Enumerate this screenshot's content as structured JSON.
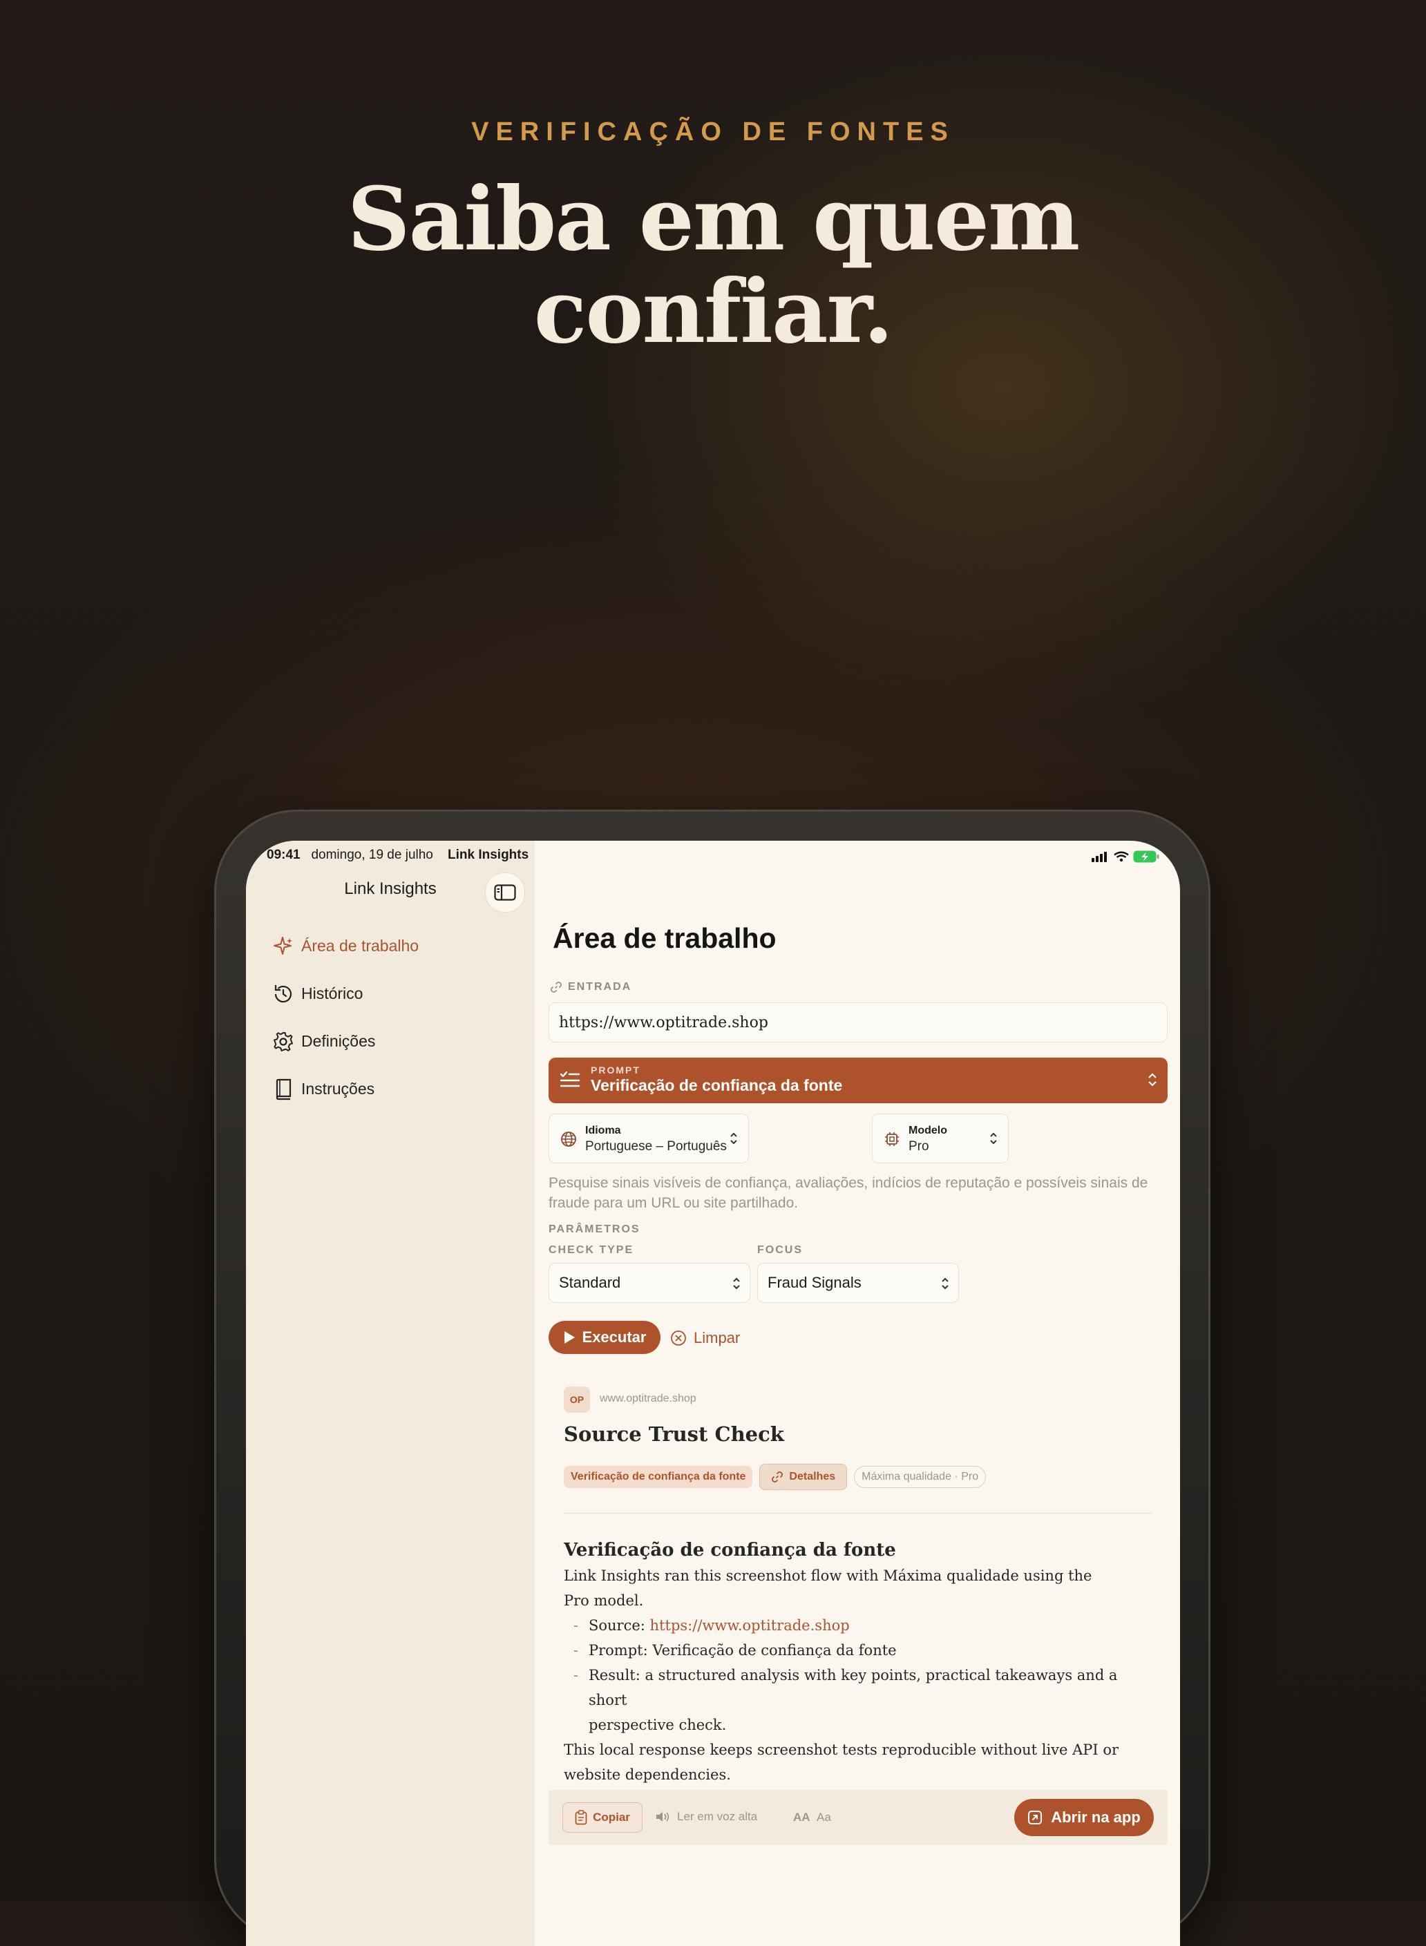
{
  "hero": {
    "eyebrow": "VERIFICAÇÃO DE FONTES",
    "headline_line1": "Saiba em quem",
    "headline_line2": "confiar."
  },
  "status_bar": {
    "time": "09:41",
    "date": "domingo, 19 de julho",
    "app": "Link Insights"
  },
  "sidebar": {
    "title": "Link Insights",
    "items": [
      {
        "label": "Área de trabalho",
        "icon": "sparkle-icon",
        "active": true
      },
      {
        "label": "Histórico",
        "icon": "history-icon",
        "active": false
      },
      {
        "label": "Definições",
        "icon": "gear-icon",
        "active": false
      },
      {
        "label": "Instruções",
        "icon": "book-icon",
        "active": false
      }
    ]
  },
  "workspace": {
    "title": "Área de trabalho",
    "entrada_label": "ENTRADA",
    "url_value": "https://www.optitrade.shop",
    "prompt": {
      "label": "PROMPT",
      "value": "Verificação de confiança da fonte"
    },
    "idioma": {
      "label": "Idioma",
      "value": "Portuguese – Português"
    },
    "modelo": {
      "label": "Modelo",
      "value": "Pro"
    },
    "description": "Pesquise sinais visíveis de confiança, avaliações, indícios de reputação e possíveis sinais de fraude para um URL ou site partilhado.",
    "params_label": "PARÂMETROS",
    "check_type": {
      "label": "CHECK TYPE",
      "value": "Standard"
    },
    "focus": {
      "label": "FOCUS",
      "value": "Fraud Signals"
    },
    "run_label": "Executar",
    "clear_label": "Limpar"
  },
  "result": {
    "avatar": "OP",
    "domain": "www.optitrade.shop",
    "title": "Source Trust Check",
    "tags": {
      "prompt": "Verificação de confiança da fonte",
      "details": "Detalhes",
      "quality": "Máxima qualidade · Pro"
    },
    "heading": "Verificação de confiança da fonte",
    "intro_line1": "Link Insights ran this screenshot flow with Máxima qualidade using the",
    "intro_line2": "Pro model.",
    "source_label": "Source:",
    "source_url": "https://www.optitrade.shop",
    "prompt_line": "Prompt: Verificação de confiança da fonte",
    "result_line1": "Result: a structured analysis with key points, practical takeaways and a short",
    "result_line2": "perspective check.",
    "outro_line1": "This local response keeps screenshot tests reproducible without live API or",
    "outro_line2": "website dependencies."
  },
  "footer": {
    "copy_label": "Copiar",
    "tts_label": "Ler em voz alta",
    "font_large": "AA",
    "font_small": "Aa",
    "open_label": "Abrir na app"
  },
  "colors": {
    "accent": "#ae522b",
    "gold": "#d49a4b",
    "sidebar_bg": "#f1eadd",
    "content_bg": "#fbf7ef"
  }
}
